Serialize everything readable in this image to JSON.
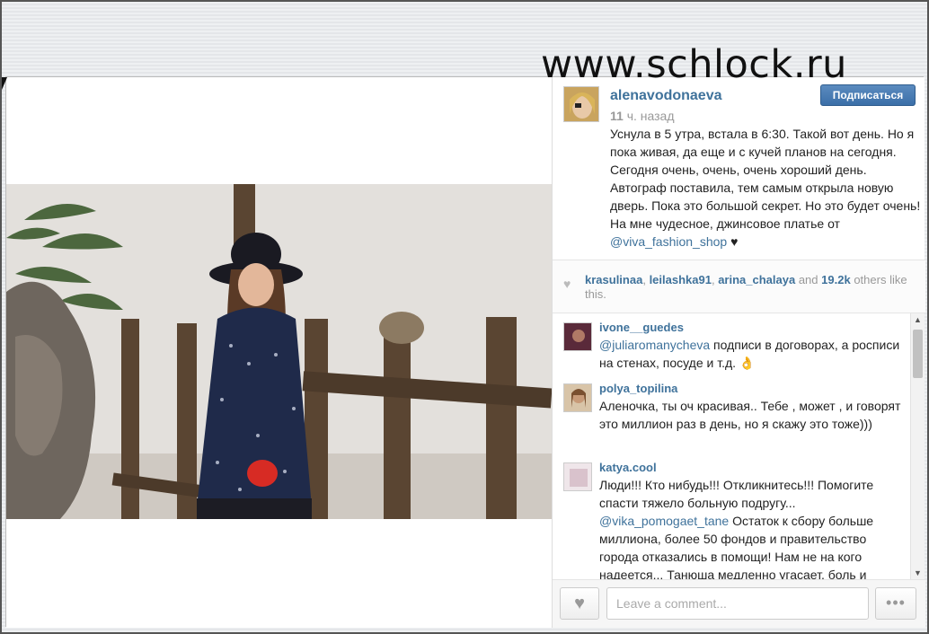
{
  "watermark": "www.schlock.ru",
  "post": {
    "username": "alenavodonaeva",
    "follow_label": "Подписаться",
    "time_num": "11",
    "time_unit": "ч. назад",
    "caption_main": "Уснула в 5 утра, встала в 6:30. Такой вот день. Но я пока живая, да еще и с кучей планов на сегодня. Сегодня очень, очень, очень хороший день. Автограф поставила, тем самым открыла новую дверь. Пока это большой секрет. Но это будет очень! На мне чудесное, джинсовое платье от ",
    "caption_link": "@viva_fashion_shop",
    "caption_tail": " ♥"
  },
  "likes": {
    "users": [
      "krasulinaa",
      "leilashka91",
      "arina_chalaya"
    ],
    "and": "and",
    "count": "19.2k",
    "suffix": "others like this."
  },
  "comments": [
    {
      "user": "ivone__guedes",
      "mention": "@juliaromanycheva",
      "text": " подписи в договорах, а росписи на стенах, посуде и т.д. 👌"
    },
    {
      "user": "polya_topilina",
      "mention": "",
      "text": "Аленочка, ты оч красивая.. Тебе , может , и говорят это миллион раз в день, но я скажу это тоже)))"
    },
    {
      "user": "katya.cool",
      "mention": "",
      "text": "Люди!!! Кто нибудь!!! Откликнитесь!!! Помогите спасти тяжело больную подругу... ",
      "mention2": "@vika_pomogaet_tane",
      "text2": " Остаток к сбору больше миллиона, более 50 фондов и правительство города отказались в помощи! Нам не на кого надеется... Танюша медленно угасает, боль и"
    }
  ],
  "footer": {
    "comment_placeholder": "Leave a comment...",
    "more_label": "•••"
  },
  "icons": {
    "heart": "♥",
    "scroll_up": "▲",
    "scroll_down": "▼"
  },
  "colors": {
    "link": "#3f729b",
    "follow_button": "#3b6fa8"
  }
}
